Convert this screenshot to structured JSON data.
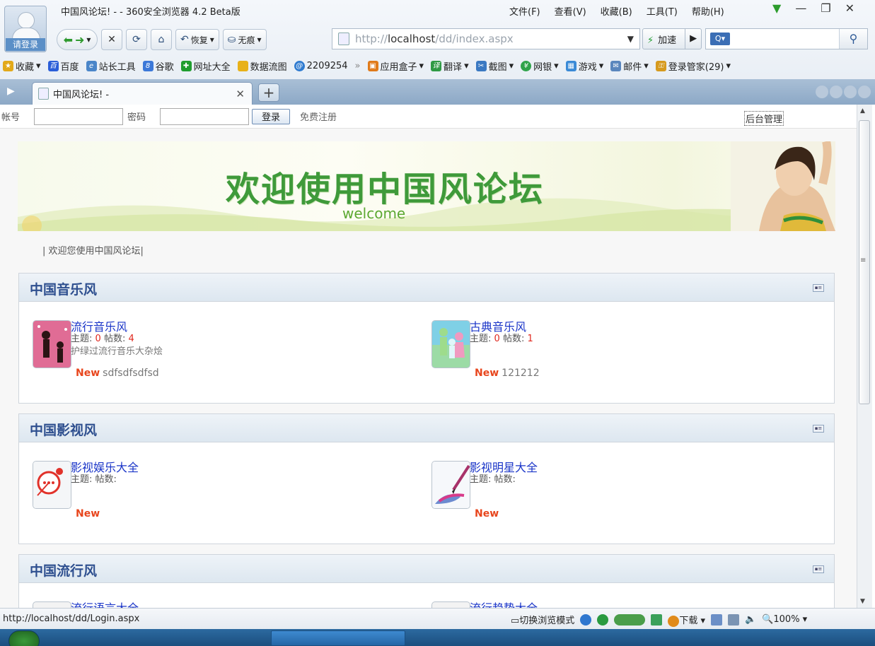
{
  "window": {
    "title": "中国风论坛! - - 360安全浏览器 4.2 Beta版",
    "menu": [
      "文件(F)",
      "查看(V)",
      "收藏(B)",
      "工具(T)",
      "帮助(H)"
    ],
    "avatar_label": "请登录"
  },
  "navbar": {
    "restore_label": "恢复",
    "incognito_label": "无痕",
    "address_prefix": "http://",
    "address_host": "localhost",
    "address_path": "/dd/index.aspx",
    "speed_label": "加速"
  },
  "favorites": [
    {
      "label": "收藏",
      "color": "#e2a91a",
      "icon": "star-icon"
    },
    {
      "label": "百度",
      "color": "#2b5ed8",
      "icon": "baidu-icon"
    },
    {
      "label": "站长工具",
      "color": "#4b86c9",
      "icon": "page-icon"
    },
    {
      "label": "谷歌",
      "color": "#3c78d8",
      "icon": "google-icon"
    },
    {
      "label": "网址大全",
      "color": "#1f9d2e",
      "icon": "globe-icon"
    },
    {
      "label": "数据流图",
      "color": "#e8b119",
      "icon": "folder-icon"
    },
    {
      "label": "2209254",
      "color": "#2f7bd0",
      "icon": "qq-icon"
    }
  ],
  "favorites_right": [
    {
      "label": "应用盒子",
      "color": "#e07a1a",
      "icon": "box-icon"
    },
    {
      "label": "翻译",
      "color": "#2f9a44",
      "icon": "translate-icon"
    },
    {
      "label": "截图",
      "color": "#3b79c2",
      "icon": "screenshot-icon"
    },
    {
      "label": "网银",
      "color": "#2fa34a",
      "icon": "bank-icon"
    },
    {
      "label": "游戏",
      "color": "#3a8ad6",
      "icon": "game-icon"
    },
    {
      "label": "邮件",
      "color": "#5a86bd",
      "icon": "mail-icon"
    },
    {
      "label": "登录管家(29)",
      "color": "#d69a1e",
      "icon": "key-icon"
    }
  ],
  "tab": {
    "title": "中国风论坛! -"
  },
  "loginbar": {
    "account_label": "帐号",
    "password_label": "密码",
    "login_button": "登录",
    "register_link": "免费注册",
    "admin_link": "后台管理"
  },
  "banner": {
    "title": "欢迎使用中国风论坛",
    "subtitle": "welcome"
  },
  "welcome_text": "| 欢迎您使用中国风论坛|",
  "sections": [
    {
      "title": "中国音乐风",
      "forums": [
        {
          "name": "流行音乐风",
          "topics_label": "主题:",
          "topics": "0",
          "posts_label": "帖数:",
          "posts": "4",
          "desc": "护绿过流行音乐大杂烩",
          "new_label": "New",
          "latest": "sdfsdfsdfsd",
          "icon": "pop-music-icon"
        },
        {
          "name": "古典音乐风",
          "topics_label": "主题:",
          "topics": "0",
          "posts_label": "帖数:",
          "posts": "1",
          "desc": "",
          "new_label": "New",
          "latest": "121212",
          "icon": "classical-music-icon"
        }
      ]
    },
    {
      "title": "中国影视风",
      "forums": [
        {
          "name": "影视娱乐大全",
          "topics_label": "主题:",
          "topics": "",
          "posts_label": "帖数:",
          "posts": "",
          "desc": "",
          "new_label": "New",
          "latest": "",
          "icon": "chat-bubble-icon"
        },
        {
          "name": "影视明星大全",
          "topics_label": "主题:",
          "topics": "",
          "posts_label": "帖数:",
          "posts": "",
          "desc": "",
          "new_label": "New",
          "latest": "",
          "icon": "brush-icon"
        }
      ]
    },
    {
      "title": "中国流行风",
      "forums": [
        {
          "name": "流行语言大全",
          "icon": "page-icon"
        },
        {
          "name": "流行趋势大全",
          "icon": "page-icon"
        }
      ]
    }
  ],
  "statusbar": {
    "url": "http://localhost/dd/Login.aspx",
    "switch_mode": "切换浏览模式",
    "download": "下载",
    "zoom": "100%"
  }
}
